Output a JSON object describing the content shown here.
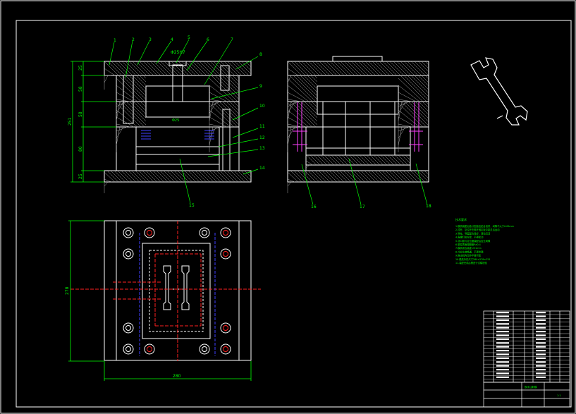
{
  "drawing": {
    "colors": {
      "background": "#000000",
      "outline": "#ffffff",
      "dimension": "#00ff00",
      "centerline": "#ff2020",
      "hidden": "#ff40ff",
      "hatch": "#bbbbbb",
      "bolt": "#00ffff",
      "spring": "#0000ff"
    },
    "balloons": [
      "1",
      "2",
      "3",
      "4",
      "5",
      "6",
      "7",
      "8",
      "9",
      "10",
      "11",
      "12",
      "13",
      "14",
      "15",
      "16",
      "17",
      "18"
    ],
    "front_view": {
      "dims_vertical": [
        "25",
        "58",
        "58",
        "80",
        "25"
      ],
      "overall_height": "251",
      "top_dim": "Φ25H7"
    },
    "plan_view": {
      "width_dim": "280",
      "height_dim": "278"
    },
    "notes": {
      "title": "技术要求",
      "lines": [
        "1.模具装配后各分型面应贴合良好，间隙不大于0.02mm",
        "2.顶杆、复位杆在推杆固定板中能灵活运动",
        "3.导柱、导套配合良好，滑动灵活",
        "4.各螺钉应拧紧，不得松动",
        "5.浇口套与定位圈装配后应无间隙",
        "6.型腔表面粗糙度Ra0.4",
        "7.模具闭合高度 251mm",
        "8.冷却水道畅通，不得渗漏",
        "9.推出机构动作平稳可靠",
        "10.模具外形尺寸280×278×251",
        "11.装配完成后需进行试模检验"
      ]
    },
    "title_block": {
      "drawing_name": "扳手注射模",
      "scale": "1:1"
    }
  }
}
